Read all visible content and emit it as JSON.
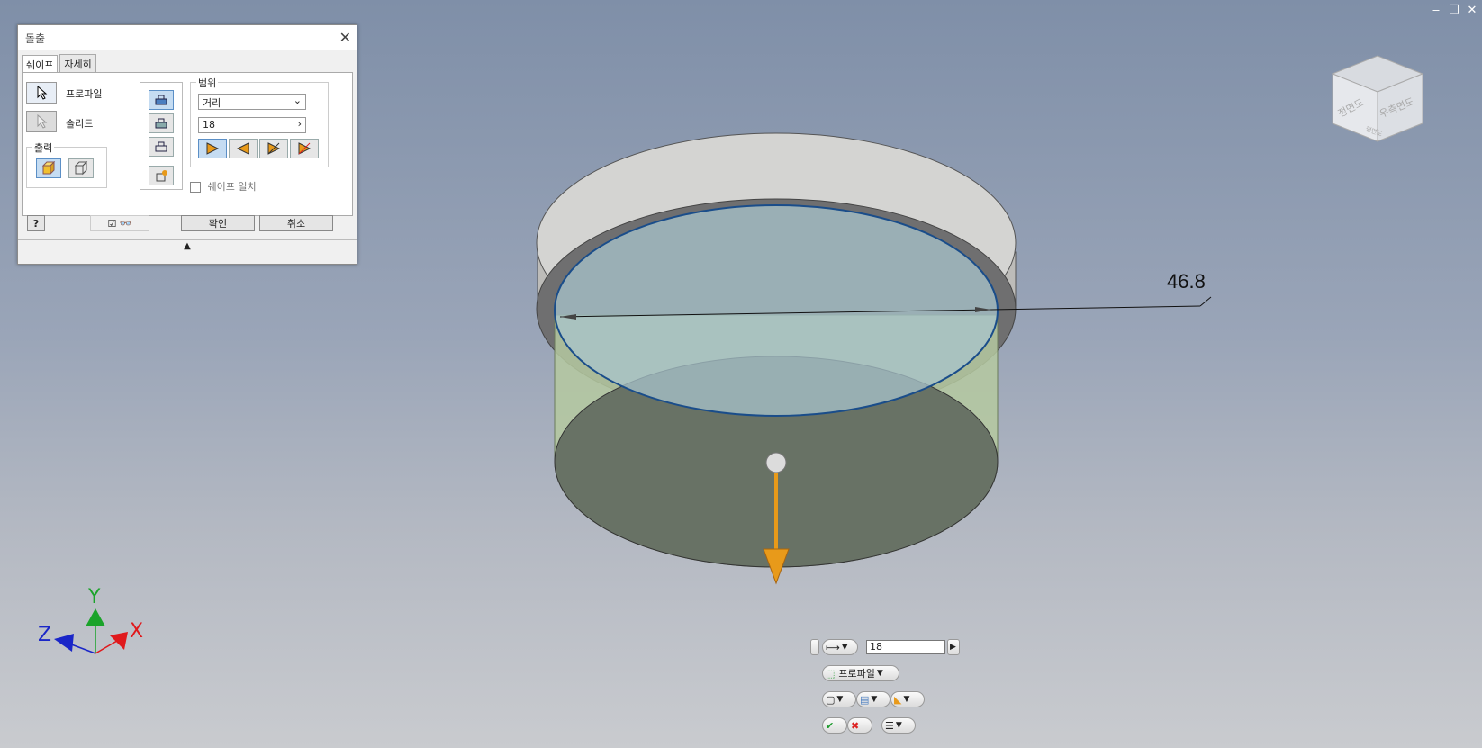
{
  "window": {
    "minimize": "‒",
    "restore": "❐",
    "close": "✕"
  },
  "dialog": {
    "title": "돌출",
    "close": "✕",
    "tabs": [
      {
        "label": "쉐이프"
      },
      {
        "label": "자세히"
      }
    ],
    "profile_label": "프로파일",
    "solid_label": "솔리드",
    "output_group": "출력",
    "extents_group": "범위",
    "extents_type": "거리",
    "distance_value": "18",
    "match_shape_label": "쉐이프 일치",
    "ok_label": "확인",
    "cancel_label": "취소",
    "help_glyph": "?",
    "expander_glyph": "▲"
  },
  "viewport": {
    "dimension_value": "46.8",
    "viewcube": {
      "face_front": "정면도",
      "face_right": "우측면도",
      "face_top": "평면도"
    },
    "axes": {
      "x": "X",
      "y": "Y",
      "z": "Z"
    },
    "colors": {
      "top_disc": "#d4d4d2",
      "profile_fill": "#a8c4cc",
      "extrude_fill": "#b5c9a0",
      "arrow": "#e89a1a",
      "axis_x": "#e0191c",
      "axis_y": "#1aa32a",
      "axis_z": "#1a26c8"
    }
  },
  "minitoolbar": {
    "distance_value": "18",
    "profile_label": "프로파일"
  }
}
